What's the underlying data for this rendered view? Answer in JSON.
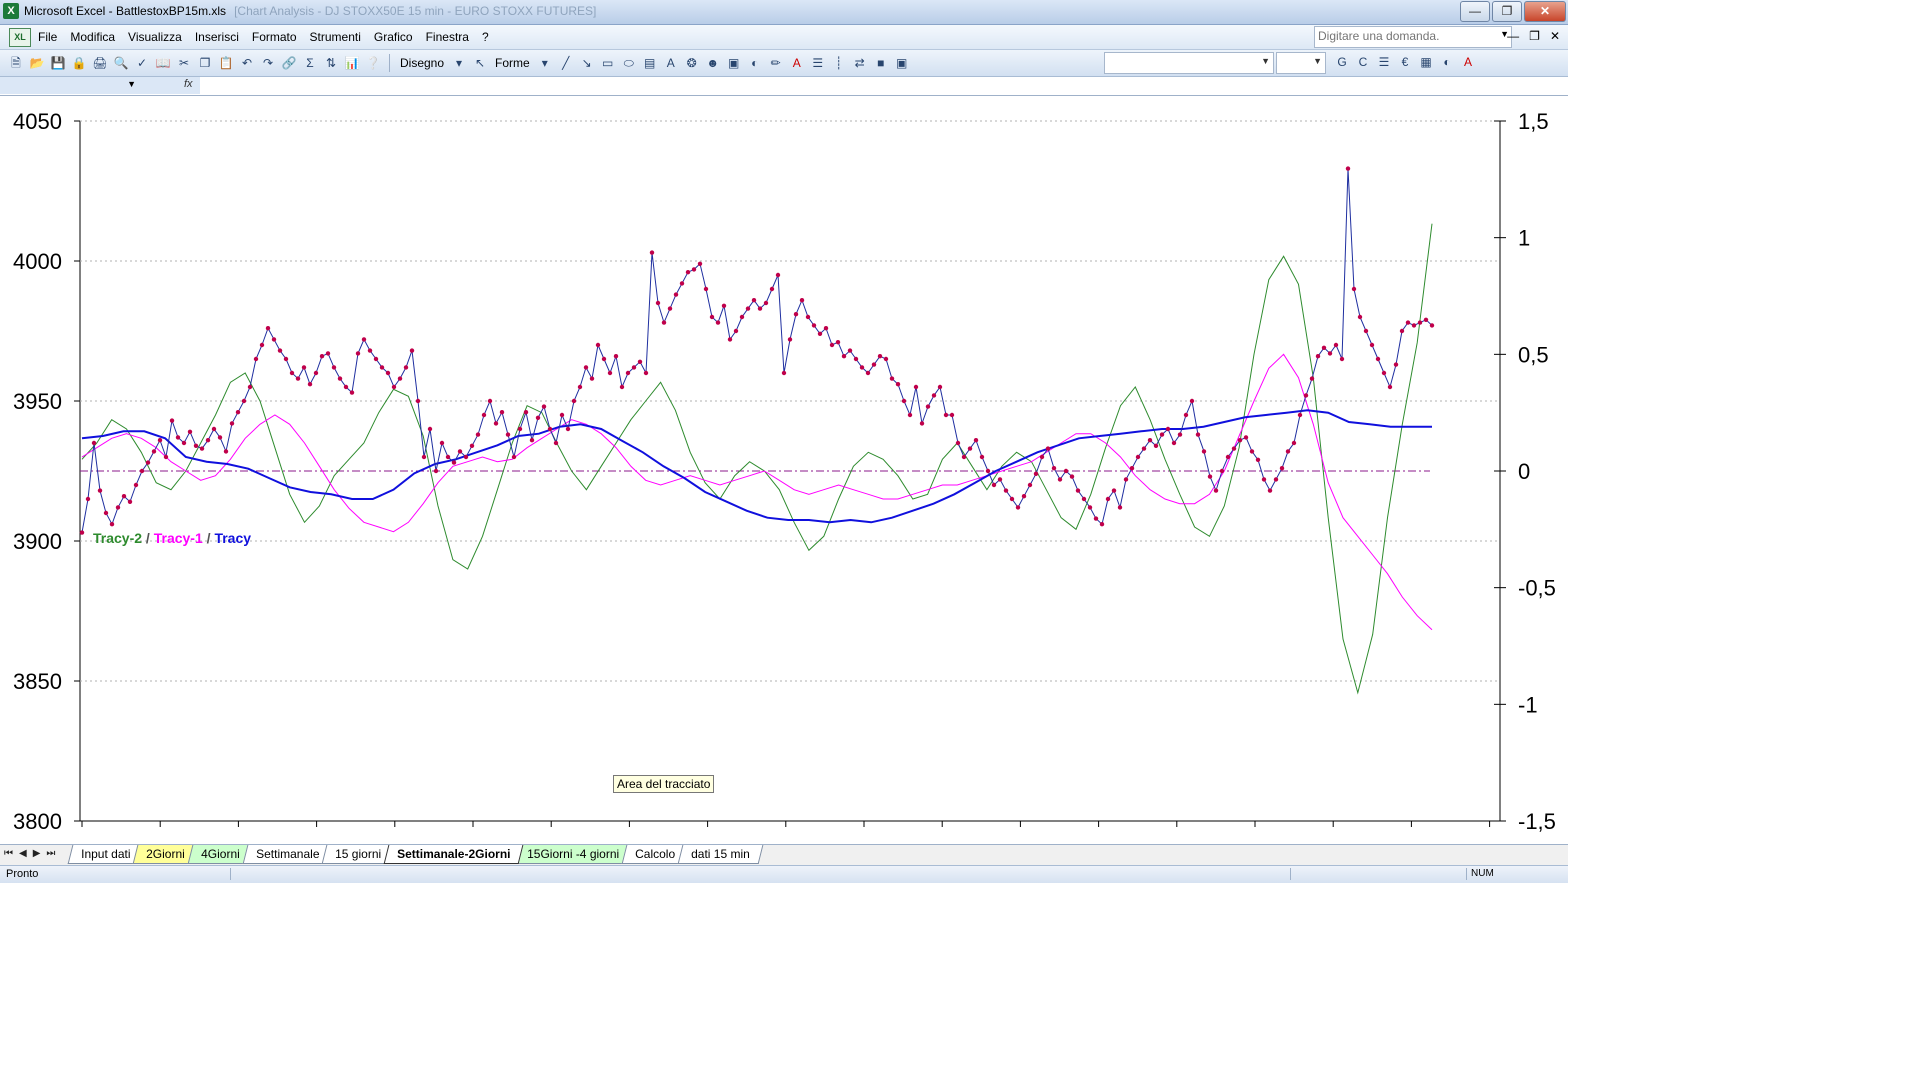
{
  "window": {
    "app_title": "Microsoft Excel - BattlestoxBP15m.xls",
    "background_title": "[Chart Analysis - DJ STOXX50E 15 min - EURO STOXX FUTURES]"
  },
  "menu": {
    "items": [
      "File",
      "Modifica",
      "Visualizza",
      "Inserisci",
      "Formato",
      "Strumenti",
      "Grafico",
      "Finestra",
      "?"
    ],
    "question_placeholder": "Digitare una domanda."
  },
  "toolbar": {
    "draw_label": "Disegno",
    "shapes_label": "Forme",
    "bold_label": "G",
    "italic_label": "C",
    "euro_label": "€"
  },
  "formula_bar": {
    "fx_label": "fx"
  },
  "tooltip": {
    "text": "Area del tracciato"
  },
  "sheet_tabs": [
    {
      "label": "Input dati",
      "color": "#ffffff"
    },
    {
      "label": "2Giorni",
      "color": "#ffff99"
    },
    {
      "label": "4Giorni",
      "color": "#ccffcc"
    },
    {
      "label": "Settimanale",
      "color": "#ffffff"
    },
    {
      "label": "15 giorni",
      "color": "#ffffff"
    },
    {
      "label": "Settimanale-2Giorni",
      "color": "#ffffff",
      "active": true
    },
    {
      "label": "15Giorni -4 giorni",
      "color": "#ccffcc"
    },
    {
      "label": "Calcolo",
      "color": "#ffffff"
    },
    {
      "label": "dati 15 min",
      "color": "#ffffff"
    }
  ],
  "status": {
    "ready": "Pronto",
    "num": "NUM"
  },
  "chart_data": {
    "type": "line",
    "legend_text": {
      "t2": "Tracy-2",
      "t1": "Tracy-1",
      "t0": "Tracy",
      "sep": " / "
    },
    "y_left": {
      "min": 3800,
      "max": 4050,
      "ticks": [
        "4050",
        "4000",
        "3950",
        "3900",
        "3850",
        "3800"
      ],
      "tick_values": [
        4050,
        4000,
        3950,
        3900,
        3850,
        3800
      ]
    },
    "y_right": {
      "min": -1.5,
      "max": 1.5,
      "ticks": [
        "1,5",
        "1",
        "0,5",
        "0",
        "-0,5",
        "-1",
        "-1,5"
      ],
      "tick_values": [
        1.5,
        1,
        0.5,
        0,
        -0.5,
        -1,
        -1.5
      ]
    },
    "grid": "horizontal-dotted",
    "colors": {
      "price": "#1f2fa0",
      "marker": "#c0004a",
      "tracy2": "#2e8b2e",
      "tracy1": "#ff00ff",
      "tracy": "#1010dd",
      "zero": "#8b1a8b"
    },
    "price_series": {
      "name": "Price",
      "values": [
        3903,
        3915,
        3935,
        3918,
        3910,
        3906,
        3912,
        3916,
        3914,
        3920,
        3925,
        3928,
        3932,
        3936,
        3930,
        3943,
        3937,
        3935,
        3939,
        3934,
        3933,
        3936,
        3940,
        3937,
        3932,
        3942,
        3946,
        3950,
        3955,
        3965,
        3970,
        3976,
        3972,
        3968,
        3965,
        3960,
        3958,
        3962,
        3956,
        3960,
        3966,
        3967,
        3962,
        3958,
        3955,
        3953,
        3967,
        3972,
        3968,
        3965,
        3962,
        3960,
        3955,
        3958,
        3962,
        3968,
        3950,
        3930,
        3940,
        3925,
        3935,
        3930,
        3928,
        3932,
        3930,
        3934,
        3938,
        3945,
        3950,
        3942,
        3946,
        3938,
        3930,
        3940,
        3946,
        3936,
        3944,
        3948,
        3940,
        3935,
        3945,
        3940,
        3950,
        3955,
        3962,
        3958,
        3970,
        3965,
        3960,
        3966,
        3955,
        3960,
        3962,
        3964,
        3960,
        4003,
        3985,
        3978,
        3983,
        3988,
        3992,
        3996,
        3997,
        3999,
        3990,
        3980,
        3978,
        3984,
        3972,
        3975,
        3980,
        3983,
        3986,
        3983,
        3985,
        3990,
        3995,
        3960,
        3972,
        3981,
        3986,
        3980,
        3977,
        3974,
        3976,
        3970,
        3971,
        3966,
        3968,
        3965,
        3962,
        3960,
        3963,
        3966,
        3965,
        3958,
        3956,
        3950,
        3945,
        3955,
        3942,
        3948,
        3952,
        3955,
        3945,
        3945,
        3935,
        3930,
        3933,
        3936,
        3930,
        3925,
        3920,
        3922,
        3918,
        3915,
        3912,
        3916,
        3920,
        3924,
        3930,
        3933,
        3926,
        3922,
        3925,
        3923,
        3918,
        3915,
        3912,
        3908,
        3906,
        3915,
        3918,
        3912,
        3922,
        3926,
        3930,
        3933,
        3936,
        3934,
        3938,
        3940,
        3935,
        3938,
        3945,
        3950,
        3938,
        3932,
        3923,
        3918,
        3925,
        3930,
        3933,
        3936,
        3937,
        3932,
        3929,
        3922,
        3918,
        3922,
        3926,
        3932,
        3935,
        3945,
        3952,
        3958,
        3966,
        3969,
        3967,
        3970,
        3965,
        4033,
        3990,
        3980,
        3975,
        3970,
        3965,
        3960,
        3955,
        3963,
        3975,
        3978,
        3977,
        3978,
        3979,
        3977
      ]
    },
    "tracy2_series": {
      "name": "Tracy-2",
      "values": [
        0.05,
        0.12,
        0.22,
        0.18,
        0.08,
        -0.05,
        -0.08,
        0.0,
        0.12,
        0.24,
        0.38,
        0.42,
        0.3,
        0.1,
        -0.1,
        -0.22,
        -0.15,
        -0.02,
        0.05,
        0.12,
        0.25,
        0.35,
        0.32,
        0.15,
        -0.15,
        -0.38,
        -0.42,
        -0.28,
        -0.08,
        0.12,
        0.28,
        0.25,
        0.12,
        0.0,
        -0.08,
        0.02,
        0.12,
        0.22,
        0.3,
        0.38,
        0.26,
        0.08,
        -0.05,
        -0.12,
        -0.02,
        0.04,
        0.0,
        -0.08,
        -0.22,
        -0.34,
        -0.28,
        -0.12,
        0.02,
        0.08,
        0.05,
        -0.02,
        -0.12,
        -0.1,
        0.05,
        0.12,
        0.02,
        -0.08,
        0.02,
        0.08,
        0.04,
        -0.08,
        -0.2,
        -0.25,
        -0.1,
        0.1,
        0.28,
        0.36,
        0.22,
        0.05,
        -0.1,
        -0.24,
        -0.28,
        -0.15,
        0.1,
        0.5,
        0.82,
        0.92,
        0.8,
        0.4,
        -0.2,
        -0.72,
        -0.95,
        -0.7,
        -0.2,
        0.2,
        0.55,
        1.06
      ]
    },
    "tracy1_series": {
      "name": "Tracy-1",
      "values": [
        0.06,
        0.1,
        0.14,
        0.16,
        0.14,
        0.1,
        0.04,
        0.0,
        -0.04,
        -0.02,
        0.05,
        0.14,
        0.2,
        0.24,
        0.2,
        0.12,
        0.02,
        -0.08,
        -0.16,
        -0.22,
        -0.24,
        -0.26,
        -0.22,
        -0.14,
        -0.05,
        0.02,
        0.04,
        0.06,
        0.04,
        0.05,
        0.1,
        0.14,
        0.18,
        0.22,
        0.2,
        0.16,
        0.1,
        0.02,
        -0.04,
        -0.06,
        -0.04,
        -0.02,
        -0.04,
        -0.06,
        -0.04,
        -0.02,
        0.0,
        -0.04,
        -0.08,
        -0.1,
        -0.08,
        -0.06,
        -0.08,
        -0.1,
        -0.12,
        -0.12,
        -0.1,
        -0.08,
        -0.06,
        -0.06,
        -0.04,
        -0.02,
        0.0,
        0.02,
        0.04,
        0.08,
        0.12,
        0.16,
        0.16,
        0.12,
        0.06,
        -0.02,
        -0.08,
        -0.12,
        -0.14,
        -0.14,
        -0.1,
        0.0,
        0.15,
        0.3,
        0.44,
        0.5,
        0.4,
        0.2,
        -0.05,
        -0.2,
        -0.28,
        -0.36,
        -0.44,
        -0.54,
        -0.62,
        -0.68
      ]
    },
    "tracy_series": {
      "name": "Tracy",
      "values": [
        0.14,
        0.15,
        0.17,
        0.17,
        0.14,
        0.06,
        0.04,
        0.03,
        0.01,
        -0.03,
        -0.07,
        -0.09,
        -0.1,
        -0.12,
        -0.12,
        -0.08,
        -0.01,
        0.03,
        0.05,
        0.08,
        0.11,
        0.15,
        0.16,
        0.19,
        0.2,
        0.18,
        0.13,
        0.08,
        0.02,
        -0.03,
        -0.09,
        -0.13,
        -0.17,
        -0.2,
        -0.21,
        -0.21,
        -0.22,
        -0.21,
        -0.22,
        -0.2,
        -0.17,
        -0.14,
        -0.1,
        -0.05,
        0.0,
        0.04,
        0.08,
        0.11,
        0.14,
        0.15,
        0.16,
        0.17,
        0.18,
        0.18,
        0.19,
        0.21,
        0.23,
        0.24,
        0.25,
        0.26,
        0.25,
        0.21,
        0.2,
        0.19,
        0.19,
        0.19
      ]
    }
  }
}
